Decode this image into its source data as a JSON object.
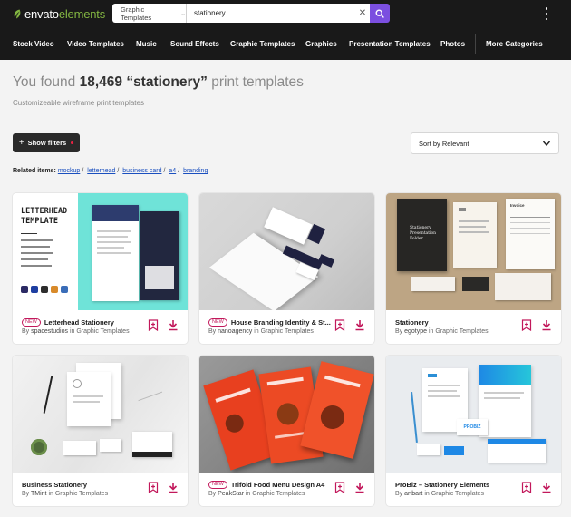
{
  "header": {
    "logo": {
      "part1": "envato",
      "part2": "elements"
    },
    "search": {
      "category": "Graphic Templates",
      "query": "stationery"
    },
    "nav": [
      "Stock Video",
      "Video Templates",
      "Music",
      "Sound Effects",
      "Graphic Templates",
      "Graphics",
      "Presentation Templates",
      "Photos",
      "More Categories"
    ]
  },
  "results": {
    "prefix": "You found",
    "count": "18,469",
    "query": "“stationery”",
    "suffix": "print templates",
    "subtitle": "Customizeable wireframe print templates"
  },
  "filters": {
    "show_label": "Show filters",
    "sort_label": "Sort by Relevant"
  },
  "related": {
    "label": "Related items:",
    "items": [
      "mockup",
      "letterhead",
      "business card",
      "a4",
      "branding"
    ]
  },
  "cards": [
    {
      "title": "Letterhead Stationery",
      "byline": "By",
      "author": "spacestudios",
      "in": "in Graphic Templates",
      "new": "NEW",
      "thumb_heading": "LETTERHEAD TEMPLATE"
    },
    {
      "title": "House Branding Identity & St...",
      "byline": "By",
      "author": "nanoagency",
      "in": "in Graphic Templates",
      "new": "NEW"
    },
    {
      "title": "Stationery",
      "byline": "By",
      "author": "egotype",
      "in": "in Graphic Templates",
      "thumb_heading": "Stationery Presentation Folder",
      "thumb_invoice": "Invoice"
    },
    {
      "title": "Business Stationery",
      "byline": "By",
      "author": "TMint",
      "in": "in Graphic Templates"
    },
    {
      "title": "Trifold Food Menu Design A4",
      "byline": "By",
      "author": "PeakStar",
      "in": "in Graphic Templates",
      "new": "NEW"
    },
    {
      "title": "ProBiz – Stationery Elements",
      "byline": "By",
      "author": "artbart",
      "in": "in Graphic Templates",
      "thumb_brand": "PROBIZ"
    }
  ],
  "colors": {
    "accent": "#7b4fe0",
    "brand_green": "#82b541",
    "icon_pink": "#c2185b"
  }
}
